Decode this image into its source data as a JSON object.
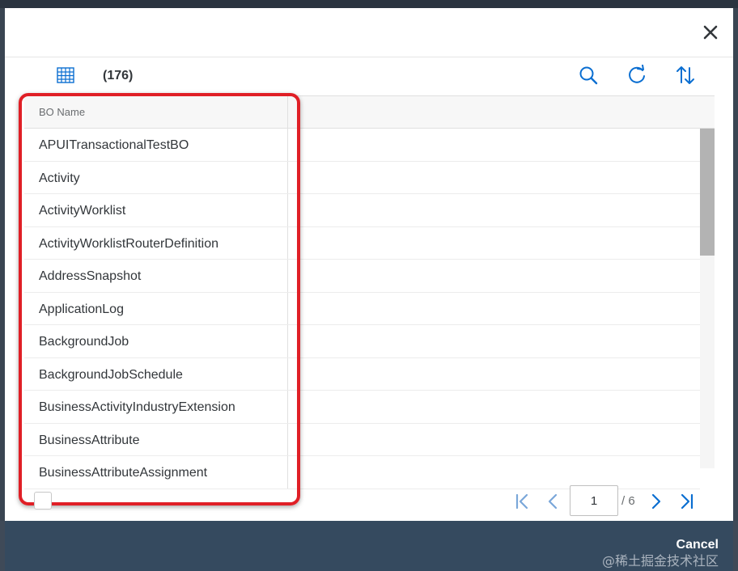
{
  "header": {
    "count": "(176)"
  },
  "table": {
    "column_header": "BO Name",
    "rows": [
      "APUITransactionalTestBO",
      "Activity",
      "ActivityWorklist",
      "ActivityWorklistRouterDefinition",
      "AddressSnapshot",
      "ApplicationLog",
      "BackgroundJob",
      "BackgroundJobSchedule",
      "BusinessActivityIndustryExtension",
      "BusinessAttribute",
      "BusinessAttributeAssignment"
    ]
  },
  "pagination": {
    "current_page": "1",
    "total": "/ 6"
  },
  "footer": {
    "cancel_label": "Cancel"
  },
  "watermark": "@稀土掘金技术社区",
  "colors": {
    "highlight": "#e01f26",
    "footer_bg": "#354a5f",
    "icon_blue": "#0a6ed1"
  },
  "icons": [
    "close-icon",
    "table-grid-icon",
    "search-icon",
    "refresh-icon",
    "sort-icon",
    "first-page-icon",
    "previous-page-icon",
    "next-page-icon",
    "last-page-icon"
  ]
}
